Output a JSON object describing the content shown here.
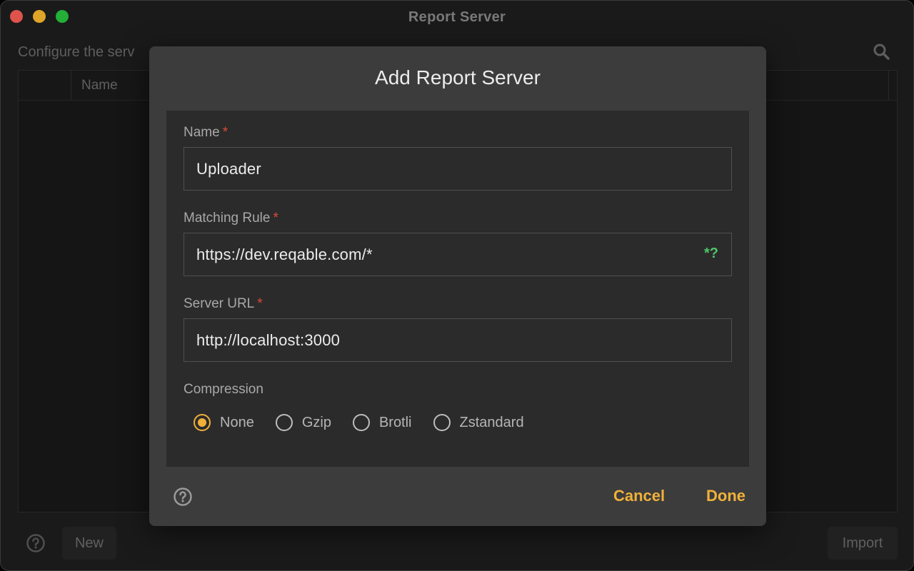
{
  "window": {
    "title": "Report Server"
  },
  "main": {
    "description": "Configure the serv",
    "columns": {
      "name": "Name"
    },
    "buttons": {
      "new": "New",
      "import": "Import"
    }
  },
  "dialog": {
    "title": "Add Report Server",
    "fields": {
      "name": {
        "label": "Name",
        "value": "Uploader",
        "required": "*"
      },
      "matching_rule": {
        "label": "Matching Rule",
        "value": "https://dev.reqable.com/*",
        "required": "*",
        "regex_badge": "*?"
      },
      "server_url": {
        "label": "Server URL",
        "value": "http://localhost:3000",
        "required": "*"
      }
    },
    "compression": {
      "label": "Compression",
      "options": [
        "None",
        "Gzip",
        "Brotli",
        "Zstandard"
      ],
      "selected": "None"
    },
    "buttons": {
      "cancel": "Cancel",
      "done": "Done"
    }
  },
  "colors": {
    "accent": "#f0b13a",
    "required": "#e0483a",
    "regex": "#4fc46a"
  },
  "icons": [
    "search-icon",
    "help-icon",
    "regex-icon"
  ]
}
